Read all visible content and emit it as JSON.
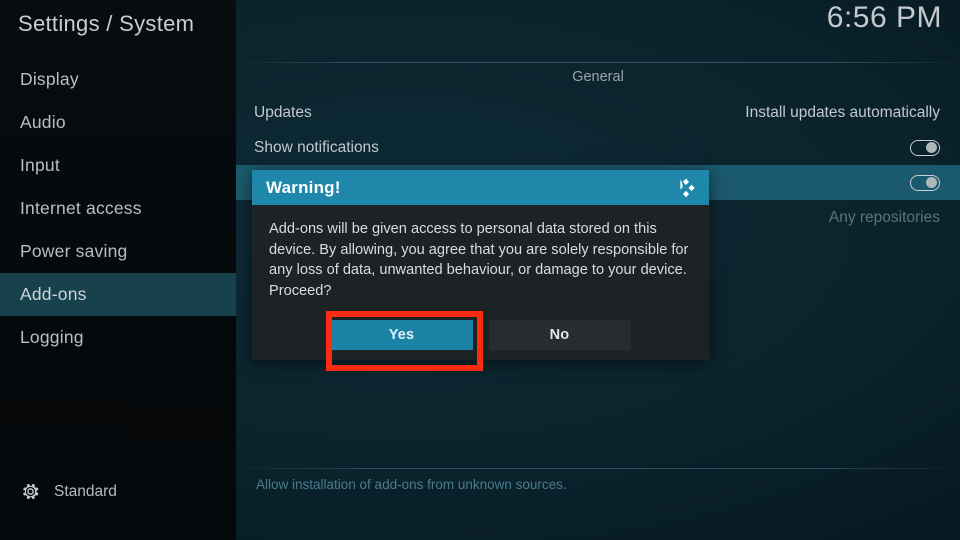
{
  "header": {
    "title": "Settings / System",
    "clock": "6:56 PM"
  },
  "sidebar": {
    "items": [
      {
        "label": "Display",
        "selected": false
      },
      {
        "label": "Audio",
        "selected": false
      },
      {
        "label": "Input",
        "selected": false
      },
      {
        "label": "Internet access",
        "selected": false
      },
      {
        "label": "Power saving",
        "selected": false
      },
      {
        "label": "Add-ons",
        "selected": true
      },
      {
        "label": "Logging",
        "selected": false
      }
    ],
    "profile": {
      "icon": "gear-icon",
      "label": "Standard"
    }
  },
  "main": {
    "section_label": "General",
    "rows": [
      {
        "label": "Updates",
        "value": "Install updates automatically",
        "control": "text"
      },
      {
        "label": "Show notifications",
        "value": "",
        "control": "toggle",
        "toggle_on": true
      },
      {
        "label": "",
        "value": "",
        "control": "toggle",
        "toggle_on": true,
        "highlighted": true
      },
      {
        "label": "",
        "value": "Any repositories",
        "control": "text",
        "dim": true
      }
    ],
    "help_text": "Allow installation of add-ons from unknown sources."
  },
  "dialog": {
    "title": "Warning!",
    "logo_icon": "kodi-logo-icon",
    "message": "Add-ons will be given access to personal data stored on this device. By allowing, you agree that you are solely responsible for any loss of data, unwanted behaviour, or damage to your device. Proceed?",
    "buttons": [
      {
        "label": "Yes",
        "kind": "primary"
      },
      {
        "label": "No",
        "kind": "secondary"
      }
    ]
  },
  "annotation": {
    "target": "Yes",
    "color": "#fb2c12"
  },
  "colors": {
    "accent_teal": "#1f87aa",
    "sidebar_selected": "#17414d",
    "row_highlight": "#1b5a6e",
    "background": "#0a222c",
    "annotation_red": "#fb2c12"
  }
}
